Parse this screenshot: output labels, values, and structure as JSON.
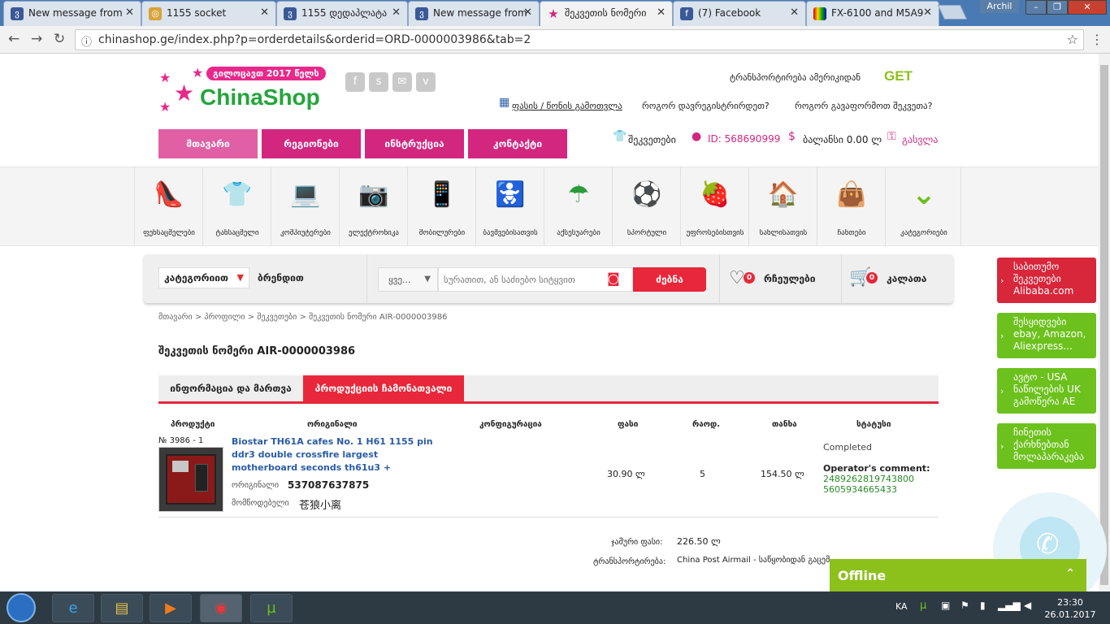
{
  "browser": {
    "tabs": [
      {
        "title": "New message from",
        "icon": "facebook-icon"
      },
      {
        "title": "1155 socket",
        "icon": "coin-icon"
      },
      {
        "title": "1155 დედაპლატა",
        "icon": "page-icon"
      },
      {
        "title": "New message from",
        "icon": "facebook-icon"
      },
      {
        "title": "შეკვეთის ნომერი",
        "icon": "star-icon",
        "active": true
      },
      {
        "title": "(7) Facebook",
        "icon": "facebook-icon"
      },
      {
        "title": "FX-6100 and M5A9",
        "icon": "image-icon"
      }
    ],
    "user": "Archil",
    "url": "chinashop.ge/index.php?p=orderdetails&orderid=ORD-0000003986&tab=2"
  },
  "header": {
    "pill": "გილოცავთ 2017 წელს",
    "logo": "ChinaShop",
    "social": [
      "f",
      "s",
      "✉",
      "v"
    ],
    "transport_label": "ტრანსპორტირება ამერიკიდან",
    "get_logo": "GET",
    "links": {
      "calc": "ფასის / წონის გამოთვლა",
      "register": "როგორ დავრეგისტრირდეთ?",
      "order": "როგორ გავაფორმოთ შეკვეთა?"
    }
  },
  "menu": [
    "მთავარი",
    "რეგიონები",
    "ინსტრუქცია",
    "კონტაქტი"
  ],
  "account": {
    "orders": "შეკვეთები",
    "id_label": "ID: 568690999",
    "balance": "ბალანსი 0.00 ლ",
    "logout": "გასვლა"
  },
  "categories": [
    {
      "label": "ფეხსაცმელები",
      "icon": "👠"
    },
    {
      "label": "ტანსაცმელი",
      "icon": "👕"
    },
    {
      "label": "კომპიუტერები",
      "icon": "💻"
    },
    {
      "label": "ელექტრონიკა",
      "icon": "📷"
    },
    {
      "label": "მობილურები",
      "icon": "📱"
    },
    {
      "label": "ბავშვებისათვის",
      "icon": "🚼"
    },
    {
      "label": "აქსესუარები",
      "icon": "☂"
    },
    {
      "label": "სპორტული",
      "icon": "⚽"
    },
    {
      "label": "უფროსებისთვის",
      "icon": "🍓"
    },
    {
      "label": "სახლისათვის",
      "icon": "🏠"
    },
    {
      "label": "ჩანთები",
      "icon": "👜"
    },
    {
      "label": "კატეგორიები",
      "icon": "⌄"
    }
  ],
  "search": {
    "category": "კატეგორიით",
    "brand": "ბრენდით",
    "scope": "ყვე...",
    "placeholder": "სურათით, ან საძიებო სიტყვით",
    "button": "ძებნა",
    "wishlist": "რჩეულები",
    "wishlist_count": "0",
    "cart": "კალათა",
    "cart_count": "0"
  },
  "breadcrumbs": "მთავარი  >  პროფილი  >  შეკვეთები  >  შეკვეთის ნომერი AIR-0000003986",
  "order": {
    "title": "შეკვეთის ნომერი AIR-0000003986",
    "tabs": [
      "ინფორმაცია და მართვა",
      "პროდუქციის ჩამონათვალი"
    ],
    "columns": [
      "პროდუქტი",
      "ორიგინალი",
      "კონფიგურაცია",
      "ფასი",
      "რაოდ.",
      "თანხა",
      "სტატუსი"
    ],
    "item": {
      "number": "№ 3986 - 1",
      "title_line1": "Biostar TH61A cafes No. 1 H61 1155 pin",
      "title_line2": "ddr3 double crossfire largest",
      "title_line3": "motherboard seconds th61u3 +",
      "orig_label": "ორიგინალი",
      "orig_value": "537087637875",
      "seller_label": "მომწოდებელი",
      "seller_value": "苍狼小离",
      "price": "30.90 ლ",
      "qty": "5",
      "sum": "154.50 ლ",
      "status": "Completed",
      "comment_label": "Operator's comment:",
      "comment_line1": "2489262819743800",
      "comment_line2": "5605934665433"
    },
    "total_label": "ჯამური ფასი:",
    "total_value": "226.50 ლ",
    "transport_label": "ტრანსპორტირება:",
    "transport_value": "China Post Airmail - საწყობიდან გაცემ..."
  },
  "promos": [
    {
      "text": "საბითუმო შეკვეთები Alibaba.com",
      "color": "#d8263a"
    },
    {
      "text": "შესყიდვები ebay, Amazon, Aliexpress...",
      "color": "#6cc11c"
    },
    {
      "text": "ავტო - USA ნაწილების UK გამოწერა AE",
      "color": "#6cc11c"
    },
    {
      "text": "ჩინეთის ქარხნებთან მოლაპარაკება",
      "color": "#6cc11c"
    }
  ],
  "chat": {
    "status": "Offline"
  },
  "taskbar": {
    "lang": "KA",
    "time": "23:30",
    "date": "26.01.2017"
  }
}
